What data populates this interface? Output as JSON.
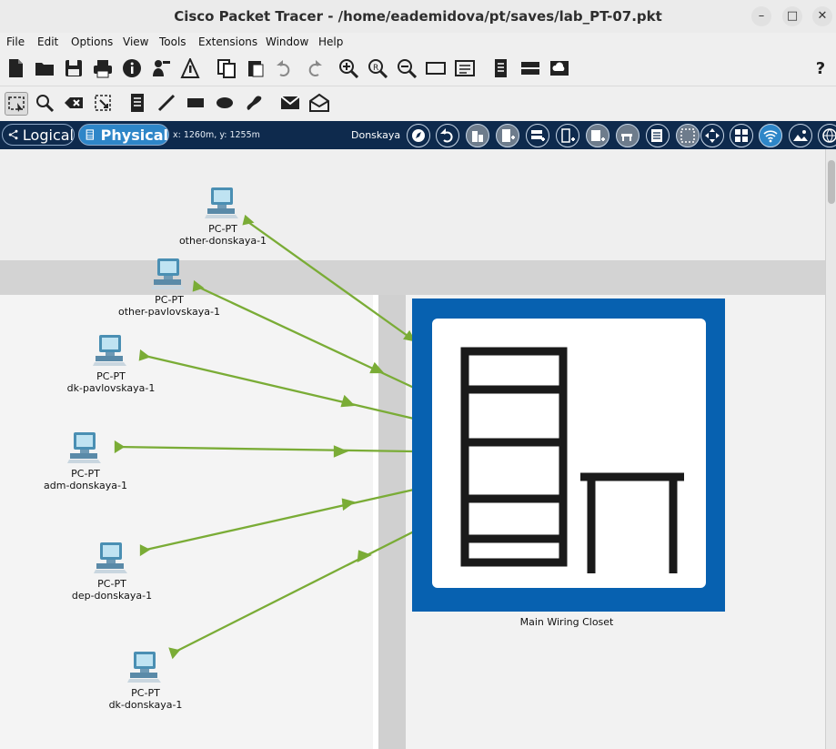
{
  "window": {
    "title": "Cisco Packet Tracer - /home/eademidova/pt/saves/lab_PT-07.pkt",
    "controls": [
      "–",
      "□",
      "✕"
    ]
  },
  "menubar": {
    "items": [
      "File",
      "Edit",
      "Options",
      "View",
      "Tools",
      "Extensions",
      "Window",
      "Help"
    ]
  },
  "toolbar_main": {
    "icons": [
      "new-file-icon",
      "open-folder-icon",
      "save-icon",
      "print-icon",
      "info-icon",
      "activity-wizard-icon",
      "network-info-icon",
      "copy-icon",
      "paste-icon",
      "undo-icon",
      "redo-icon",
      "zoom-in-icon",
      "zoom-reset-icon",
      "zoom-out-icon",
      "drawing-palette-icon",
      "custom-device-icon",
      "cluster-icon",
      "cloud-icon"
    ],
    "help": "?"
  },
  "toolbar_tools": {
    "icons": [
      "select-icon",
      "inspect-icon",
      "delete-icon",
      "resize-icon",
      "note-icon",
      "line-icon",
      "rectangle-icon",
      "ellipse-icon",
      "freeform-icon",
      "simple-pdu-icon",
      "complex-pdu-icon"
    ]
  },
  "nav": {
    "logical_label": "Logical",
    "physical_label": "Physical",
    "coords": "x: 1260m, y: 1255m",
    "location": "Donskaya"
  },
  "workspace": {
    "wiring_closet_label": "Main Wiring Closet",
    "devices": [
      {
        "type": "PC-PT",
        "name": "other-donskaya-1"
      },
      {
        "type": "PC-PT",
        "name": "other-pavlovskaya-1"
      },
      {
        "type": "PC-PT",
        "name": "dk-pavlovskaya-1"
      },
      {
        "type": "PC-PT",
        "name": "adm-donskaya-1"
      },
      {
        "type": "PC-PT",
        "name": "dep-donskaya-1"
      },
      {
        "type": "PC-PT",
        "name": "dk-donskaya-1"
      }
    ]
  },
  "colors": {
    "link": "#7aac36",
    "navbar": "#0e2a4d",
    "closet_border": "#0761b0"
  }
}
